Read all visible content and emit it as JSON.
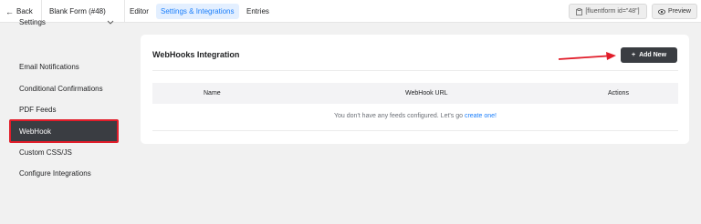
{
  "topbar": {
    "back_label": "Back",
    "form_title": "Blank Form (#48)",
    "tabs": [
      {
        "label": "Editor",
        "active": false
      },
      {
        "label": "Settings & Integrations",
        "active": true
      },
      {
        "label": "Entries",
        "active": false
      }
    ],
    "shortcode": "[fluentform id=\"48\"]",
    "preview_label": "Preview"
  },
  "sidebar": {
    "settings_label": "Settings",
    "items": [
      {
        "label": "Email Notifications"
      },
      {
        "label": "Conditional Confirmations"
      },
      {
        "label": "PDF Feeds"
      },
      {
        "label": "WebHook",
        "active": true
      },
      {
        "label": "Custom CSS/JS"
      },
      {
        "label": "Configure Integrations"
      }
    ]
  },
  "main": {
    "title": "WebHooks Integration",
    "add_button_label": "Add New",
    "table": {
      "columns": [
        "Name",
        "WebHook URL",
        "Actions"
      ],
      "empty_text": "You don't have any feeds configured. Let's go",
      "empty_link": "create one!"
    }
  },
  "colors": {
    "accent": "#1a7efb",
    "dark_button": "#3a3d42",
    "highlight_red": "#e11d2a"
  },
  "icons": {
    "back": "arrow-left-icon",
    "shortcode": "clipboard-icon",
    "preview": "eye-icon",
    "settings_toggle": "chevron-down-icon",
    "add": "plus-icon"
  }
}
